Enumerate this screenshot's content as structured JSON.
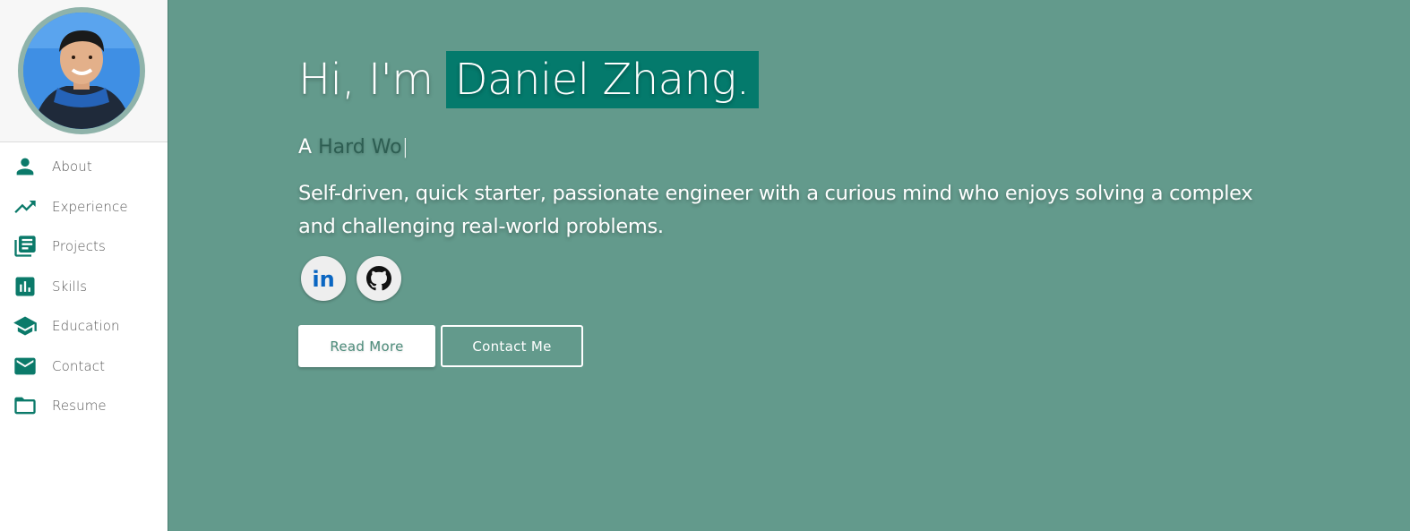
{
  "sidebar": {
    "items": [
      {
        "label": "About",
        "icon": "person-icon"
      },
      {
        "label": "Experience",
        "icon": "trending-up-icon"
      },
      {
        "label": "Projects",
        "icon": "library-books-icon"
      },
      {
        "label": "Skills",
        "icon": "bar-chart-icon"
      },
      {
        "label": "Education",
        "icon": "school-icon"
      },
      {
        "label": "Contact",
        "icon": "mail-icon"
      },
      {
        "label": "Resume",
        "icon": "folder-icon"
      }
    ]
  },
  "hero": {
    "greeting": "Hi, I'm",
    "name": "Daniel Zhang.",
    "tagline_prefix": "A",
    "tagline_typed": "Hard Wo",
    "tagline_cursor": "|",
    "bio": "Self-driven, quick starter, passionate engineer with a curious mind who enjoys solving a complex and challenging real-world problems.",
    "read_more_label": "Read More",
    "contact_label": "Contact Me",
    "social": [
      {
        "name": "linkedin",
        "icon": "linkedin-icon"
      },
      {
        "name": "github",
        "icon": "github-icon"
      }
    ]
  },
  "colors": {
    "accent": "#047a6c",
    "background": "#639a8c",
    "icon": "#0b7a6a"
  }
}
